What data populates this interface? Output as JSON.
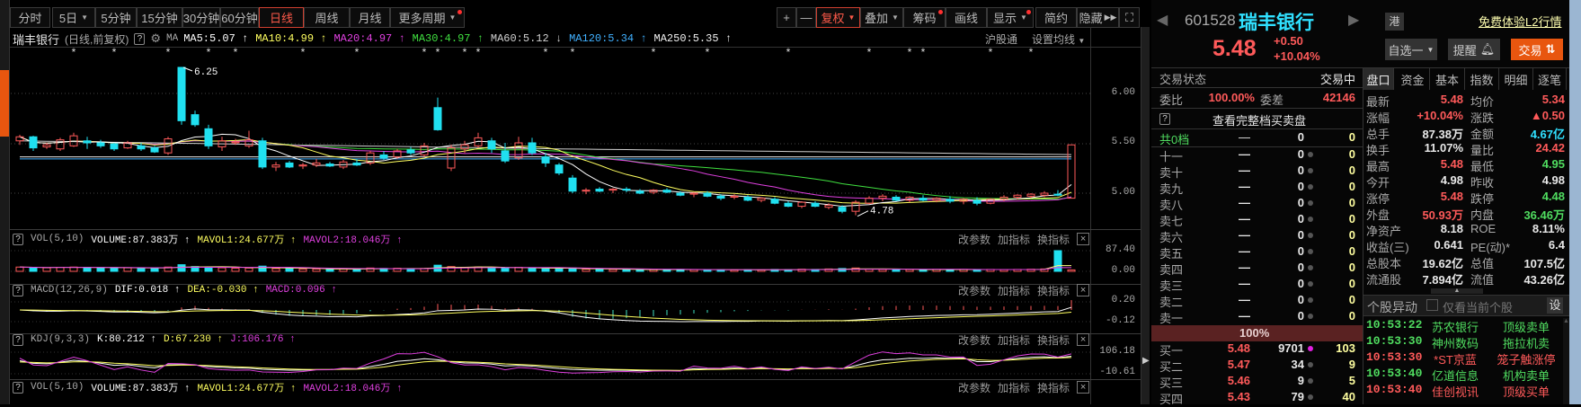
{
  "toolbar": {
    "periods": [
      "分时",
      "5日",
      "5分钟",
      "15分钟",
      "30分钟",
      "60分钟",
      "日线",
      "周线",
      "月线",
      "更多周期"
    ],
    "tools": [
      "+",
      "—",
      "复权",
      "叠加",
      "筹码",
      "画线",
      "显示",
      "简约",
      "隐藏"
    ],
    "active_period": "日线"
  },
  "chart_header": {
    "name": "瑞丰银行",
    "mode": "(日线,前复权)",
    "ma_label": "MA",
    "mas": [
      {
        "text": "MA5:5.07",
        "arrow": "↑",
        "color": "#ffffff"
      },
      {
        "text": "MA10:4.99",
        "arrow": "↑",
        "color": "#ffff60"
      },
      {
        "text": "MA20:4.97",
        "arrow": "↑",
        "color": "#e040e0"
      },
      {
        "text": "MA30:4.97",
        "arrow": "↑",
        "color": "#40e040"
      },
      {
        "text": "MA60:5.12",
        "arrow": "↓",
        "color": "#d0d0d0"
      },
      {
        "text": "MA120:5.34",
        "arrow": "↑",
        "color": "#40b0ff"
      },
      {
        "text": "MA250:5.35",
        "arrow": "↑",
        "color": "#f0f0f0"
      }
    ],
    "hgt": "沪股通",
    "set_ma": "设置均线"
  },
  "price_axis": [
    "6.00",
    "5.50",
    "5.00"
  ],
  "annotations": {
    "high": "6.25",
    "low": "4.78"
  },
  "panels": {
    "actions": [
      "改参数",
      "加指标",
      "换指标"
    ],
    "close": "×",
    "vol": {
      "name": "VOL(5,10)",
      "items": [
        {
          "text": "VOLUME:87.383万",
          "arrow": "↑",
          "color": "#ffffff"
        },
        {
          "text": "MAVOL1:24.677万",
          "arrow": "↑",
          "color": "#ffff60"
        },
        {
          "text": "MAVOL2:18.046万",
          "arrow": "↑",
          "color": "#e040e0"
        }
      ],
      "axis": [
        "87.40",
        "0.00"
      ]
    },
    "macd": {
      "name": "MACD(12,26,9)",
      "items": [
        {
          "text": "DIF:0.018",
          "arrow": "↑",
          "color": "#ffffff"
        },
        {
          "text": "DEA:-0.030",
          "arrow": "↑",
          "color": "#ffff60"
        },
        {
          "text": "MACD:0.096",
          "arrow": "↑",
          "color": "#e040e0"
        }
      ],
      "axis": [
        "0.20",
        "-0.12"
      ]
    },
    "kdj": {
      "name": "KDJ(9,3,3)",
      "items": [
        {
          "text": "K:80.212",
          "arrow": "↑",
          "color": "#ffffff"
        },
        {
          "text": "D:67.230",
          "arrow": "↑",
          "color": "#ffff60"
        },
        {
          "text": "J:106.176",
          "arrow": "↑",
          "color": "#e040e0"
        }
      ],
      "axis": [
        "106.18",
        "-10.61"
      ]
    }
  },
  "chart_data": {
    "type": "candlestick",
    "ohlc": [
      [
        5.52,
        5.58,
        5.48,
        5.56
      ],
      [
        5.56,
        5.57,
        5.42,
        5.45
      ],
      [
        5.46,
        5.5,
        5.44,
        5.48
      ],
      [
        5.44,
        5.55,
        5.42,
        5.53
      ],
      [
        5.47,
        5.6,
        5.46,
        5.57
      ],
      [
        5.52,
        5.56,
        5.44,
        5.5
      ],
      [
        5.5,
        5.53,
        5.45,
        5.47
      ],
      [
        5.49,
        5.5,
        5.42,
        5.44
      ],
      [
        5.45,
        5.52,
        5.44,
        5.5
      ],
      [
        5.47,
        5.5,
        5.42,
        5.44
      ],
      [
        5.45,
        5.47,
        5.4,
        5.41
      ],
      [
        5.4,
        5.56,
        5.38,
        5.54
      ],
      [
        6.25,
        6.25,
        5.68,
        5.72
      ],
      [
        5.78,
        5.82,
        5.66,
        5.68
      ],
      [
        5.64,
        5.68,
        5.44,
        5.47
      ],
      [
        5.46,
        5.56,
        5.42,
        5.52
      ],
      [
        5.5,
        5.54,
        5.48,
        5.51
      ],
      [
        5.47,
        5.62,
        5.45,
        5.53
      ],
      [
        5.52,
        5.55,
        5.24,
        5.26
      ],
      [
        5.26,
        5.31,
        5.22,
        5.28
      ],
      [
        5.3,
        5.32,
        5.25,
        5.26
      ],
      [
        5.27,
        5.3,
        5.24,
        5.28
      ],
      [
        5.28,
        5.34,
        5.26,
        5.3
      ],
      [
        5.29,
        5.31,
        5.26,
        5.27
      ],
      [
        5.26,
        5.33,
        5.24,
        5.31
      ],
      [
        5.3,
        5.34,
        5.27,
        5.28
      ],
      [
        5.3,
        5.42,
        5.28,
        5.4
      ],
      [
        5.38,
        5.42,
        5.33,
        5.35
      ],
      [
        5.36,
        5.44,
        5.34,
        5.42
      ],
      [
        5.43,
        5.46,
        5.38,
        5.4
      ],
      [
        5.38,
        5.5,
        5.36,
        5.47
      ],
      [
        5.85,
        5.95,
        5.62,
        5.63
      ],
      [
        5.25,
        5.48,
        5.22,
        5.45
      ],
      [
        5.44,
        5.52,
        5.4,
        5.48
      ],
      [
        5.47,
        5.6,
        5.45,
        5.55
      ],
      [
        5.52,
        5.55,
        5.4,
        5.44
      ],
      [
        5.42,
        5.5,
        5.3,
        5.32
      ],
      [
        5.35,
        5.56,
        5.33,
        5.5
      ],
      [
        5.5,
        5.55,
        5.38,
        5.4
      ],
      [
        5.36,
        5.4,
        5.26,
        5.3
      ],
      [
        5.28,
        5.3,
        5.18,
        5.2
      ],
      [
        5.15,
        5.18,
        5.0,
        5.02
      ],
      [
        5.02,
        5.05,
        4.99,
        5.03
      ],
      [
        5.04,
        5.06,
        5.01,
        5.02
      ],
      [
        5.03,
        5.05,
        5.0,
        5.04
      ],
      [
        5.04,
        5.06,
        5.01,
        5.03
      ],
      [
        5.02,
        5.04,
        4.99,
        5.0
      ],
      [
        5.01,
        5.04,
        4.99,
        5.03
      ],
      [
        5.03,
        5.05,
        5.0,
        5.01
      ],
      [
        5.0,
        5.02,
        4.97,
        4.98
      ],
      [
        4.99,
        5.01,
        4.96,
        5.0
      ],
      [
        5.0,
        5.02,
        4.96,
        4.97
      ],
      [
        4.97,
        4.99,
        4.93,
        4.95
      ],
      [
        4.96,
        4.99,
        4.94,
        4.97
      ],
      [
        4.96,
        4.98,
        4.92,
        4.93
      ],
      [
        4.93,
        4.96,
        4.91,
        4.95
      ],
      [
        4.94,
        4.96,
        4.89,
        4.9
      ],
      [
        4.9,
        4.92,
        4.86,
        4.87
      ],
      [
        4.87,
        4.92,
        4.85,
        4.91
      ],
      [
        4.9,
        4.92,
        4.86,
        4.87
      ],
      [
        4.86,
        4.9,
        4.84,
        4.88
      ],
      [
        4.86,
        4.88,
        4.8,
        4.82
      ],
      [
        4.82,
        4.93,
        4.78,
        4.91
      ],
      [
        4.9,
        4.97,
        4.89,
        4.95
      ],
      [
        4.95,
        4.99,
        4.92,
        4.97
      ],
      [
        4.96,
        4.98,
        4.92,
        4.93
      ],
      [
        4.93,
        4.97,
        4.91,
        4.96
      ],
      [
        4.95,
        4.98,
        4.92,
        4.93
      ],
      [
        4.93,
        4.96,
        4.91,
        4.95
      ],
      [
        4.94,
        4.97,
        4.9,
        4.92
      ],
      [
        4.92,
        4.95,
        4.89,
        4.94
      ],
      [
        4.93,
        4.96,
        4.88,
        4.9
      ],
      [
        4.9,
        4.95,
        4.89,
        4.94
      ],
      [
        4.94,
        4.98,
        4.92,
        4.96
      ],
      [
        4.96,
        4.99,
        4.94,
        4.98
      ],
      [
        4.97,
        5.0,
        4.95,
        4.99
      ],
      [
        4.98,
        5.02,
        4.96,
        5.0
      ],
      [
        4.99,
        5.03,
        4.97,
        4.98
      ],
      [
        4.95,
        5.48,
        4.95,
        5.48
      ]
    ],
    "volume": [
      18,
      16,
      15,
      17,
      18,
      16,
      15,
      14,
      15,
      14,
      13,
      18,
      28,
      20,
      17,
      15,
      13,
      14,
      22,
      12,
      11,
      10,
      10,
      9,
      10,
      9,
      14,
      12,
      13,
      11,
      12,
      26,
      20,
      16,
      18,
      13,
      15,
      17,
      12,
      11,
      12,
      14,
      9,
      8,
      8,
      7,
      8,
      7,
      7,
      8,
      7,
      6,
      7,
      6,
      7,
      6,
      8,
      7,
      9,
      8,
      10,
      12,
      14,
      9,
      8,
      7,
      8,
      7,
      8,
      7,
      8,
      7,
      8,
      7,
      8,
      9,
      10,
      87.38
    ],
    "price_range": [
      4.78,
      6.25
    ],
    "info_marker_indices": [
      4,
      7,
      11,
      14,
      16,
      21,
      25,
      30,
      31,
      33,
      34,
      39,
      41,
      47,
      51,
      57,
      63,
      66,
      67,
      72,
      75
    ]
  },
  "quote": {
    "code": "601528",
    "name": "瑞丰银行",
    "price": "5.48",
    "change": "+0.50",
    "change_pct": "+10.04%",
    "hk_badge": "港",
    "l2_link": "免费体验L2行情",
    "watch_btn": "自选一",
    "alert_btn": "提醒",
    "trade_btn": "交易"
  },
  "orderbook": {
    "status_label": "交易状态",
    "status_value": "交易中",
    "ratio_label": "委比",
    "ratio_value": "100.00%",
    "diff_label": "委差",
    "diff_value": "42146",
    "full_depth": "查看完整档买卖盘",
    "levels_label": "共0档",
    "levels_row": {
      "price": "—",
      "vol": "0",
      "count": "0"
    },
    "sells": [
      {
        "label": "十一",
        "price": "—",
        "vol": "0",
        "count": "0"
      },
      {
        "label": "卖十",
        "price": "—",
        "vol": "0",
        "count": "0"
      },
      {
        "label": "卖九",
        "price": "—",
        "vol": "0",
        "count": "0"
      },
      {
        "label": "卖八",
        "price": "—",
        "vol": "0",
        "count": "0"
      },
      {
        "label": "卖七",
        "price": "—",
        "vol": "0",
        "count": "0"
      },
      {
        "label": "卖六",
        "price": "—",
        "vol": "0",
        "count": "0"
      },
      {
        "label": "卖五",
        "price": "—",
        "vol": "0",
        "count": "0"
      },
      {
        "label": "卖四",
        "price": "—",
        "vol": "0",
        "count": "0"
      },
      {
        "label": "卖三",
        "price": "—",
        "vol": "0",
        "count": "0"
      },
      {
        "label": "卖二",
        "price": "—",
        "vol": "0",
        "count": "0"
      },
      {
        "label": "卖一",
        "price": "—",
        "vol": "0",
        "count": "0"
      }
    ],
    "mid_pct": "100%",
    "buys": [
      {
        "label": "买一",
        "price": "5.48",
        "vol": "9701",
        "count": "103"
      },
      {
        "label": "买二",
        "price": "5.47",
        "vol": "34",
        "count": "9"
      },
      {
        "label": "买三",
        "price": "5.46",
        "vol": "9",
        "count": "5"
      },
      {
        "label": "买四",
        "price": "5.43",
        "vol": "79",
        "count": "40"
      }
    ]
  },
  "stats": {
    "tabs": [
      "盘口",
      "资金",
      "基本",
      "指数",
      "明细",
      "逐笔"
    ],
    "rows": [
      {
        "l1": "最新",
        "v1": "5.48",
        "c1": "r",
        "l2": "均价",
        "v2": "5.34",
        "c2": "r"
      },
      {
        "l1": "涨幅",
        "v1": "+10.04%",
        "c1": "r",
        "l2": "涨跌",
        "v2": "▲0.50",
        "c2": "r"
      },
      {
        "l1": "总手",
        "v1": "87.38万",
        "c1": "w",
        "l2": "金额",
        "v2": "4.67亿",
        "c2": "c"
      },
      {
        "l1": "换手",
        "v1": "11.07%",
        "c1": "w",
        "l2": "量比",
        "v2": "24.42",
        "c2": "r"
      },
      {
        "l1": "最高",
        "v1": "5.48",
        "c1": "r",
        "l2": "最低",
        "v2": "4.95",
        "c2": "g"
      },
      {
        "l1": "今开",
        "v1": "4.98",
        "c1": "w",
        "l2": "昨收",
        "v2": "4.98",
        "c2": "w"
      },
      {
        "l1": "涨停",
        "v1": "5.48",
        "c1": "r",
        "l2": "跌停",
        "v2": "4.48",
        "c2": "g"
      },
      {
        "l1": "外盘",
        "v1": "50.93万",
        "c1": "r",
        "l2": "内盘",
        "v2": "36.46万",
        "c2": "g"
      },
      {
        "l1": "净资产",
        "v1": "8.18",
        "c1": "w",
        "l2": "ROE",
        "v2": "8.11%",
        "c2": "w"
      },
      {
        "l1": "收益(三)",
        "v1": "0.641",
        "c1": "w",
        "l2": "PE(动)*",
        "v2": "6.4",
        "c2": "w"
      },
      {
        "l1": "总股本",
        "v1": "19.62亿",
        "c1": "w",
        "l2": "总值",
        "v2": "107.5亿",
        "c2": "w"
      },
      {
        "l1": "流通股",
        "v1": "7.894亿",
        "c1": "w",
        "l2": "流值",
        "v2": "43.26亿",
        "c2": "w"
      }
    ]
  },
  "alerts": {
    "title": "个股异动",
    "filter_label": "仅看当前个股",
    "settings": "设",
    "items": [
      {
        "time": "10:53:22",
        "stock": "苏农银行",
        "event": "顶级卖单",
        "c": "g"
      },
      {
        "time": "10:53:30",
        "stock": "神州数码",
        "event": "拖拉机卖",
        "c": "g"
      },
      {
        "time": "10:53:30",
        "stock": "*ST京蓝",
        "event": "笼子触涨停",
        "c": "r"
      },
      {
        "time": "10:53:40",
        "stock": "亿道信息",
        "event": "机构卖单",
        "c": "g"
      },
      {
        "time": "10:53:40",
        "stock": "佳创视讯",
        "event": "顶级买单",
        "c": "r"
      }
    ]
  }
}
